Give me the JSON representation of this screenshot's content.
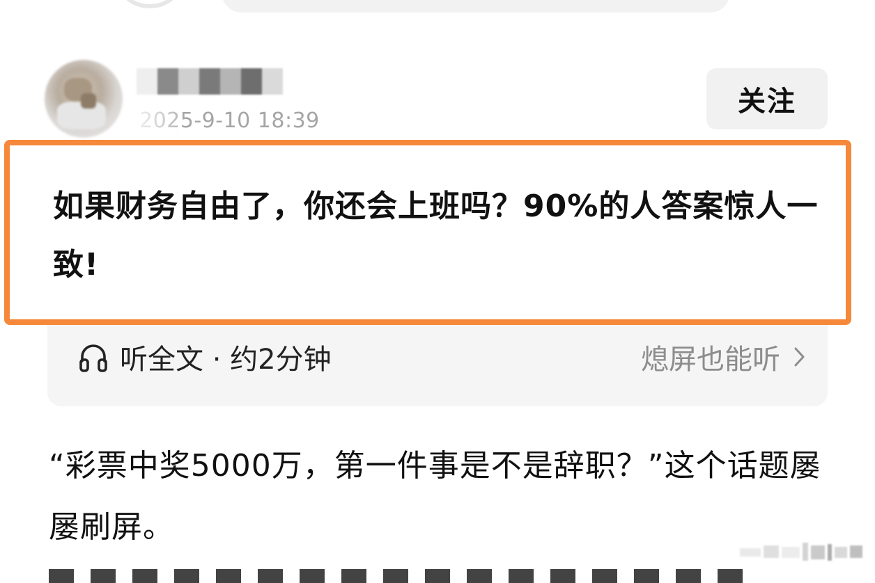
{
  "header": {
    "post_time": "2025-9-10 18:39",
    "follow_label": "关注"
  },
  "post": {
    "title": "如果财务自由了，你还会上班吗？90%的人答案惊人一致!",
    "body_text": "“彩票中奖5000万，第一件事是不是辞职？”这个话题屡屡刷屏。"
  },
  "listen_bar": {
    "listen_label": "听全文 · 约2分钟",
    "screen_off_label": "熄屏也能听"
  },
  "icons": {
    "listen_icon": "headphones-icon",
    "more_icon": "chevron-right-icon"
  },
  "colors": {
    "highlight_border": "#f5883a",
    "follow_bg": "#f1f1f2",
    "listen_bg": "#f5f5f6",
    "muted_text": "#8c8c8c",
    "time_text": "#a5a5a5"
  }
}
